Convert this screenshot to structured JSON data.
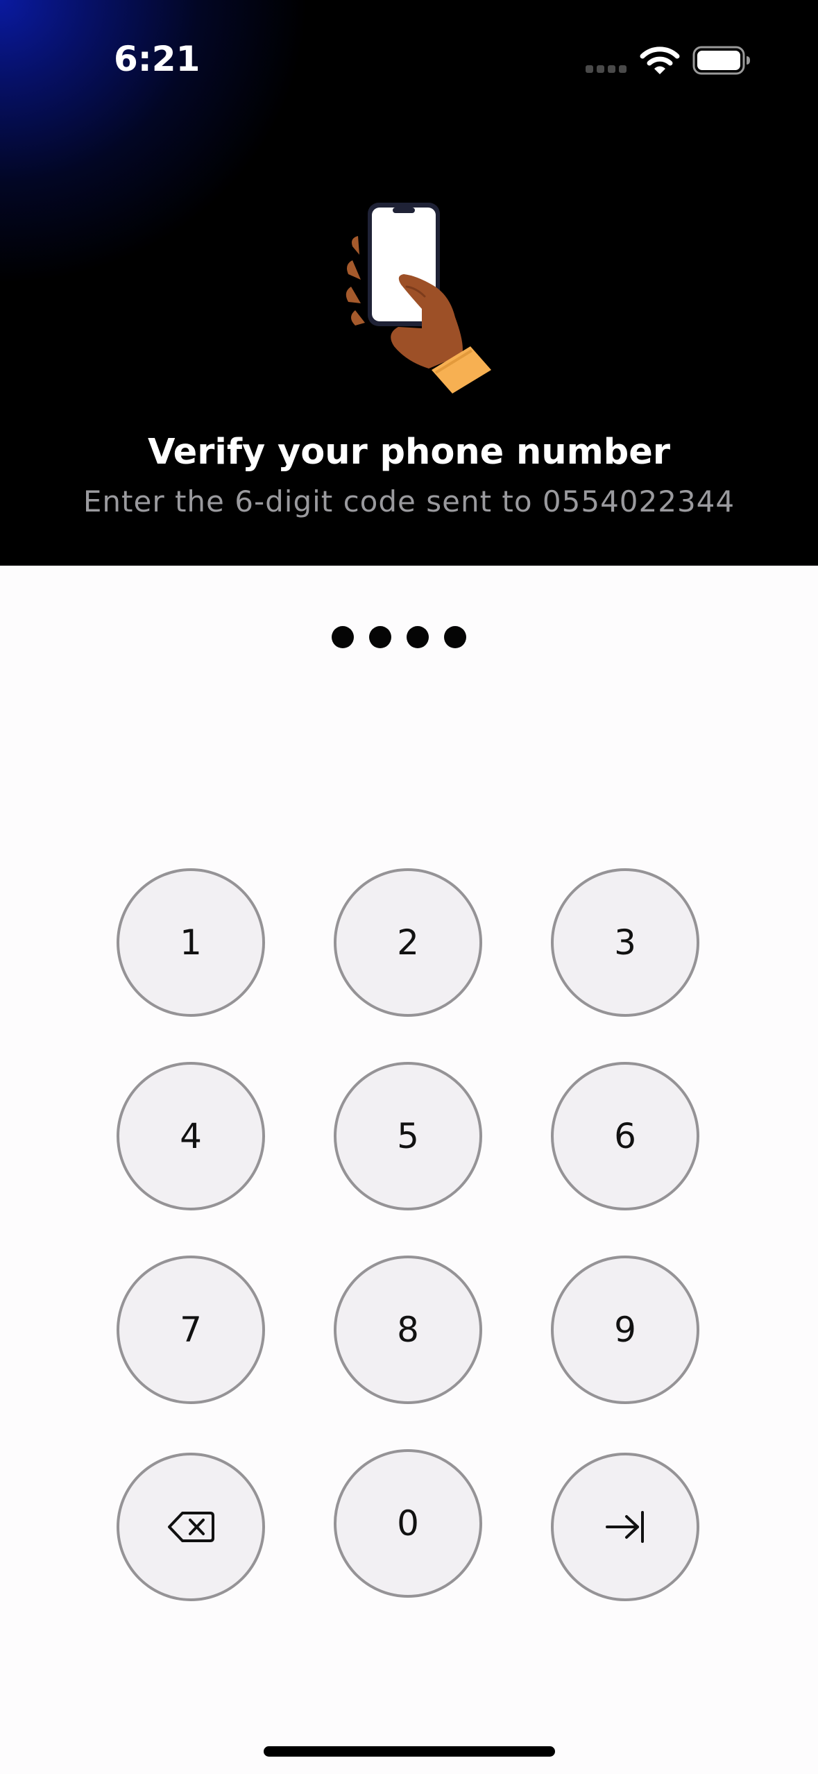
{
  "status_bar": {
    "time": "6:21",
    "signal_icon": "cellular-signal-icon",
    "wifi_icon": "wifi-icon",
    "battery_icon": "battery-icon"
  },
  "header": {
    "illustration": "hand-holding-phone-illustration",
    "title": "Verify your phone number",
    "subtitle": "Enter the 6-digit code sent to 0554022344"
  },
  "code_entry": {
    "entered_digits": 4,
    "dot_color": "#050505"
  },
  "keypad": {
    "keys": [
      "1",
      "2",
      "3",
      "4",
      "5",
      "6",
      "7",
      "8",
      "9"
    ],
    "zero": "0",
    "backspace_icon": "backspace-icon",
    "submit_icon": "arrow-right-to-bar-icon"
  },
  "colors": {
    "header_bg": "#000000",
    "accent_glow": "#0a1aa0",
    "body_bg": "#fdfcfd",
    "key_bg": "#f2f0f3",
    "key_border": "#959396",
    "subtitle": "#9a9a9e"
  }
}
